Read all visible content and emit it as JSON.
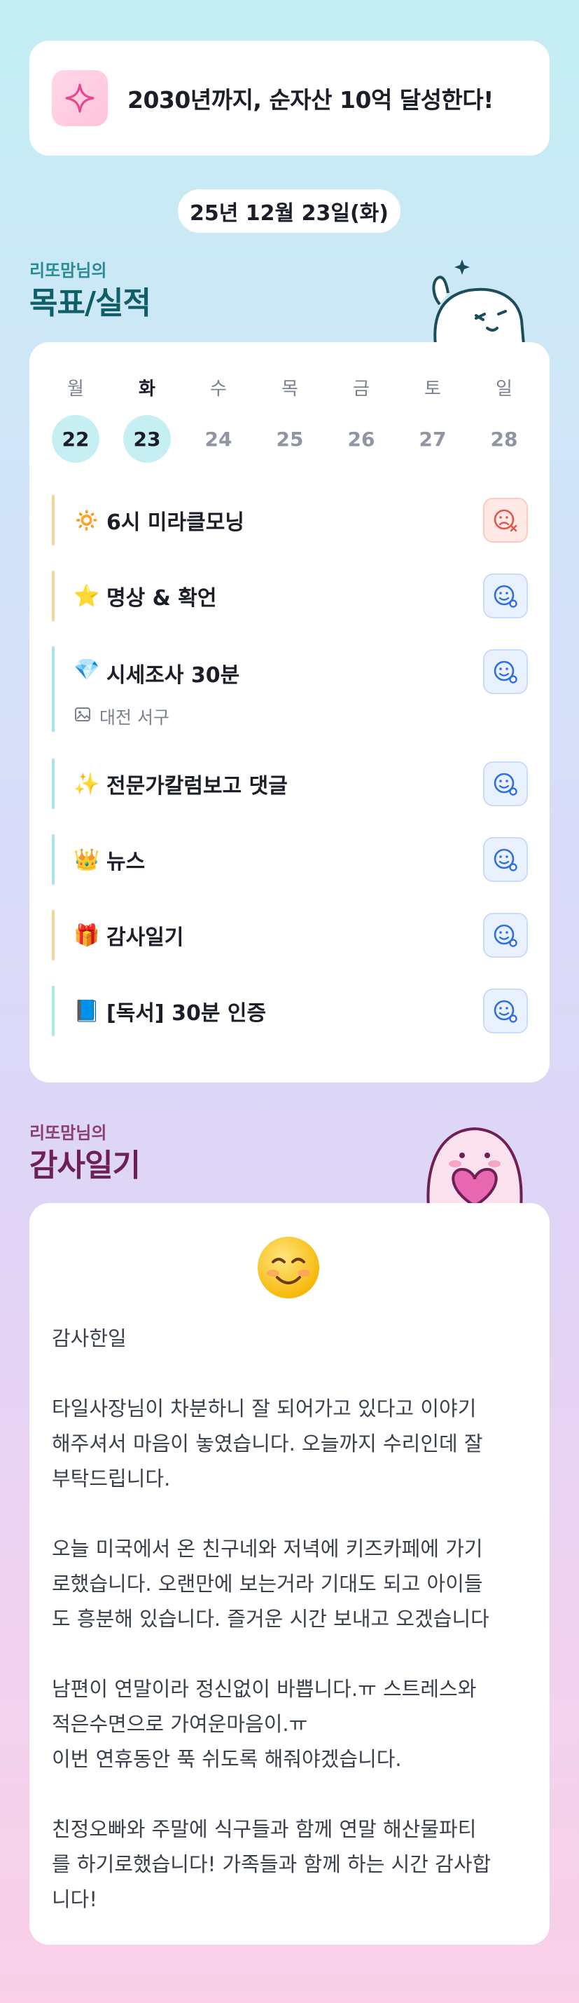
{
  "goal": {
    "text": "2030년까지, 순자산 10억 달성한다!",
    "icon": "sparkle-icon"
  },
  "date": "25년 12월 23일(화)",
  "goals_section": {
    "subtitle": "리또맘님의",
    "title": "목표/실적"
  },
  "calendar": {
    "weekdays": [
      "월",
      "화",
      "수",
      "목",
      "금",
      "토",
      "일"
    ],
    "days": [
      "22",
      "23",
      "24",
      "25",
      "26",
      "27",
      "28"
    ],
    "active_days": [
      "22",
      "23"
    ],
    "today": "화"
  },
  "tasks": [
    {
      "emoji": "🔅",
      "label": "6시 미라클모닝",
      "status": "fail",
      "bar_color": "#f6d49a"
    },
    {
      "emoji": "⭐",
      "label": "명상 & 확언",
      "status": "pending",
      "bar_color": "#f6d49a"
    },
    {
      "emoji": "💎",
      "label": "시세조사 30분",
      "status": "pending",
      "bar_color": "#a6e3ee",
      "sub": "대전 서구"
    },
    {
      "emoji": "✨",
      "label": "전문가칼럼보고 댓글",
      "status": "pending",
      "bar_color": "#a6e3ee"
    },
    {
      "emoji": "👑",
      "label": "뉴스",
      "status": "pending",
      "bar_color": "#a6e3ee"
    },
    {
      "emoji": "🎁",
      "label": "감사일기",
      "status": "pending",
      "bar_color": "#f6d49a"
    },
    {
      "emoji": "📘",
      "label": "[독서] 30분 인증",
      "status": "pending",
      "bar_color": "#a6ecd8"
    }
  ],
  "gratitude_section": {
    "subtitle": "리또맘님의",
    "title": "감사일기"
  },
  "diary": {
    "mood_icon": "smiling-face-icon",
    "heading": "감사한일",
    "paragraphs": [
      "타일사장님이 차분하니 잘 되어가고 있다고 이야기\n해주셔서 마음이 놓였습니다. 오늘까지 수리인데 잘\n부탁드립니다.",
      "오늘 미국에서 온 친구네와 저녁에 키즈카페에 가기\n로했습니다. 오랜만에 보는거라 기대도 되고 아이들\n도 흥분해 있습니다. 즐거운 시간 보내고 오겠습니다",
      "남편이 연말이라 정신없이 바쁩니다.ㅠ 스트레스와\n적은수면으로 가여운마음이.ㅠ\n이번 연휴동안 푹 쉬도록 해줘야겠습니다.",
      "친정오빠와 주말에 식구들과 함께 연말 해산물파티\n를 하기로했습니다! 가족들과 함께 하는 시간 감사합\n니다!"
    ]
  },
  "colors": {
    "accent": "#0f5e68",
    "fail": "#e2574c",
    "pending": "#2f6fe0"
  }
}
